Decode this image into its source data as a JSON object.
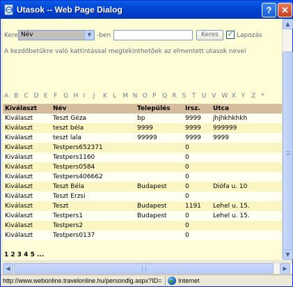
{
  "window": {
    "title": "Utasok -- Web Page Dialog",
    "help_label": "?",
    "close_label": "✕"
  },
  "search": {
    "prefix_label": "Keres",
    "field_select_value": "Név",
    "suffix_label": "-ben",
    "text_value": "",
    "button_label": "Keres",
    "checkbox_checked": true,
    "checkbox_label": "Lapozás"
  },
  "hint": "A kezdőbetűkre való kattintással megtekinthetőek az elmentett utasok nevei",
  "alphabet": [
    "A",
    "B",
    "C",
    "D",
    "E",
    "F",
    "G",
    "H",
    "I",
    "J",
    "K",
    "L",
    "M",
    "N",
    "O",
    "P",
    "Q",
    "R",
    "S",
    "T",
    "U",
    "V",
    "W",
    "X",
    "Y",
    "Z",
    "*"
  ],
  "table": {
    "headers": [
      "Kiválaszt",
      "Név",
      "Település",
      "Irsz.",
      "Utca"
    ],
    "rows": [
      [
        "Kiválaszt",
        "Teszt Géza",
        "bp",
        "9999",
        "jhjhkhkhkh"
      ],
      [
        "Kiválaszt",
        "teszt béla",
        "9999",
        "9999",
        "999999"
      ],
      [
        "Kiválaszt",
        "teszt lala",
        "99999",
        "9999",
        "9999"
      ],
      [
        "Kiválaszt",
        "Testpers652371",
        "",
        "0",
        ""
      ],
      [
        "Kiválaszt",
        "Testpers1160",
        "",
        "0",
        ""
      ],
      [
        "Kiválaszt",
        "Testpers0584",
        "",
        "0",
        ""
      ],
      [
        "Kiválaszt",
        "Testpers406662",
        "",
        "0",
        ""
      ],
      [
        "Kiválaszt",
        "Teszt Béla",
        "Budapest",
        "0",
        "Diófa u. 10"
      ],
      [
        "Kiválaszt",
        "Teszt Erzsi",
        "",
        "0",
        ""
      ],
      [
        "Kiválaszt",
        "Teszt",
        "Budapest",
        "1191",
        "Lehel u. 15."
      ],
      [
        "Kiválaszt",
        "Testpers1",
        "Budapest",
        "0",
        "Lehel u. 15."
      ],
      [
        "Kiválaszt",
        "Testpers2",
        "",
        "0",
        ""
      ],
      [
        "Kiválaszt",
        "Testpers0137",
        "",
        "0",
        ""
      ]
    ]
  },
  "pager": "1 2 3 4 5 ...",
  "status": {
    "url": "http://www.webonline.travelonline.hu/persondlg.aspx?ID=0&",
    "zone": "Internet"
  },
  "colors": {
    "title_bar": "#0046d5",
    "content_bg": "#fffdd6",
    "header_bg": "#d5bc9c",
    "row_alt_bg": "#fbf5c2",
    "link_blue": "#0b2a7f"
  }
}
